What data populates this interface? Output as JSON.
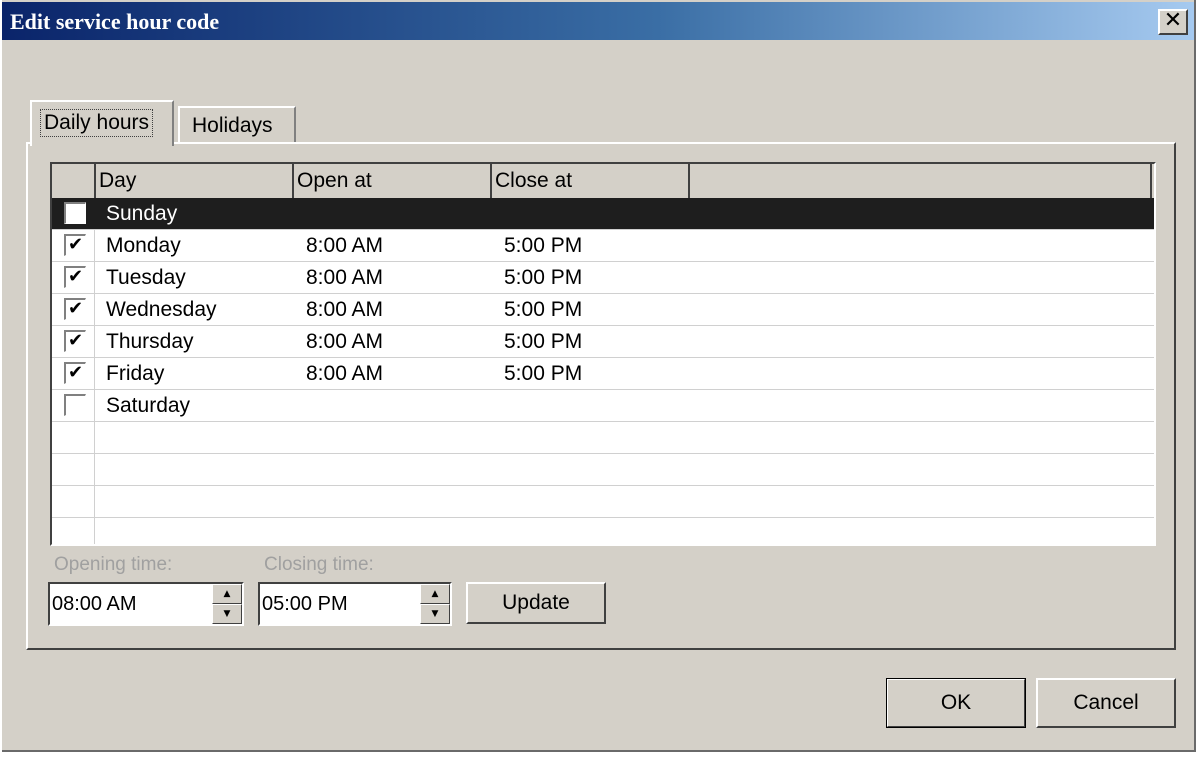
{
  "window": {
    "title": "Edit service hour code",
    "close_glyph": "✕"
  },
  "tabs": [
    {
      "label": "Daily hours",
      "active": true
    },
    {
      "label": "Holidays",
      "active": false
    }
  ],
  "grid": {
    "columns": [
      "Day",
      "Open at",
      "Close at"
    ],
    "rows": [
      {
        "checked": false,
        "day": "Sunday",
        "open": "",
        "close": "",
        "selected": true
      },
      {
        "checked": true,
        "day": "Monday",
        "open": "8:00 AM",
        "close": "5:00 PM",
        "selected": false
      },
      {
        "checked": true,
        "day": "Tuesday",
        "open": "8:00 AM",
        "close": "5:00 PM",
        "selected": false
      },
      {
        "checked": true,
        "day": "Wednesday",
        "open": "8:00 AM",
        "close": "5:00 PM",
        "selected": false
      },
      {
        "checked": true,
        "day": "Thursday",
        "open": "8:00 AM",
        "close": "5:00 PM",
        "selected": false
      },
      {
        "checked": true,
        "day": "Friday",
        "open": "8:00 AM",
        "close": "5:00 PM",
        "selected": false
      },
      {
        "checked": false,
        "day": "Saturday",
        "open": "",
        "close": "",
        "selected": false
      }
    ],
    "check_glyph": "✔"
  },
  "opening_time": {
    "label": "Opening time:",
    "value": "08:00 AM"
  },
  "closing_time": {
    "label": "Closing time:",
    "value": "05:00 PM"
  },
  "buttons": {
    "update": "Update",
    "ok": "OK",
    "cancel": "Cancel"
  },
  "spin_glyphs": {
    "up": "▲",
    "down": "▼"
  },
  "colors": {
    "title_gradient_start": "#0a246a",
    "title_gradient_end": "#a6caf0",
    "selected_row": "#1e1e1e",
    "dialog_bg": "#d4d0c8"
  }
}
